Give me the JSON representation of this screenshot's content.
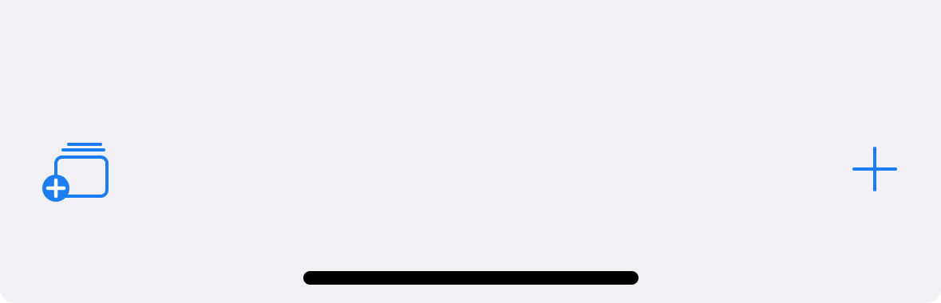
{
  "toolbar": {
    "background_color": "#f0f0f5",
    "accent_color": "#1a7ef2",
    "left_button": {
      "icon": "new-tab-group-icon"
    },
    "right_button": {
      "icon": "plus-icon"
    }
  },
  "home_indicator": {
    "color": "#000000"
  }
}
